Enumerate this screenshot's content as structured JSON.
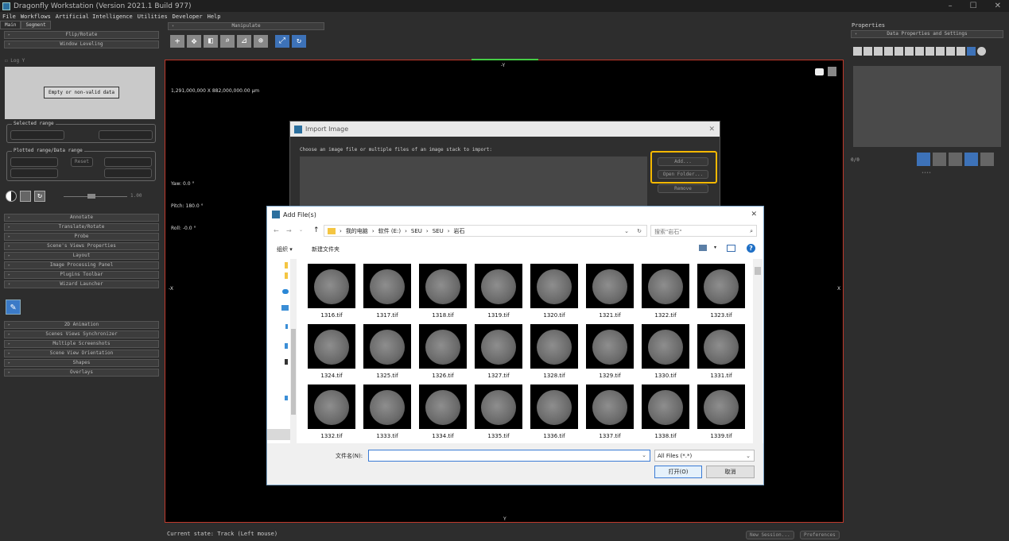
{
  "title": "Dragonfly Workstation (Version 2021.1 Build 977)",
  "window_controls": [
    "–",
    "☐",
    "✕"
  ],
  "menu": [
    "File",
    "Workflows",
    "Artificial Intelligence",
    "Utilities",
    "Developer",
    "Help"
  ],
  "left_tabs": [
    "Main",
    "Segment"
  ],
  "left_sections_top": [
    "Flip/Rotate",
    "Window Leveling"
  ],
  "logy": "Log Y",
  "empty_msg": "Empty or non-valid data",
  "selected_range": "Selected range",
  "plotted_range": "Plotted range/Data range",
  "reset": "Reset",
  "slider_value": "1.00",
  "left_sections_mid": [
    "Annotate",
    "Translate/Rotate",
    "Probe",
    "Scene's Views Properties",
    "Layout",
    "Image Processing Panel",
    "Plugins Toolbar",
    "Wizard Launcher"
  ],
  "left_sections_bot": [
    "2D Animation",
    "Scenes Views Synchronizer",
    "Multiple Screenshots",
    "Scene View Orientation",
    "Shapes",
    "Overlays"
  ],
  "manipulate": "Manipulate",
  "viewport": {
    "top": "-Y",
    "bottom": "Y",
    "left": "-X",
    "right": "X",
    "dims": "1,291,000,000 X 882,000,000.00 µm",
    "yaw": "Yaw: 0.0 °",
    "pitch": "Pitch: 180.0 °",
    "roll": "Roll: -0.0 °"
  },
  "properties": "Properties",
  "data_props": "Data Properties and Settings",
  "counter": "0/0",
  "dots": "••••",
  "status": "Current state: Track (Left mouse)",
  "new_session": "New Session...",
  "preferences": "Preferences",
  "import": {
    "title": "Import Image",
    "prompt": "Choose an image file or multiple files of an image stack to import:",
    "add": "Add...",
    "open_folder": "Open Folder...",
    "remove": "Remove"
  },
  "dialog": {
    "title": "Add File(s)",
    "path": [
      "我的电脑",
      "软件 (E:)",
      "SEU",
      "SEU",
      "岩石"
    ],
    "search_placeholder": "搜索\"岩石\"",
    "organize": "组织 ▾",
    "new_folder": "新建文件夹",
    "files": [
      "1316.tif",
      "1317.tif",
      "1318.tif",
      "1319.tif",
      "1320.tif",
      "1321.tif",
      "1322.tif",
      "1323.tif",
      "1324.tif",
      "1325.tif",
      "1326.tif",
      "1327.tif",
      "1328.tif",
      "1329.tif",
      "1330.tif",
      "1331.tif",
      "1332.tif",
      "1333.tif",
      "1334.tif",
      "1335.tif",
      "1336.tif",
      "1337.tif",
      "1338.tif",
      "1339.tif"
    ],
    "filename_label": "文件名(N):",
    "filetype": "All Files (*.*)",
    "open": "打开(O)",
    "cancel": "取消"
  }
}
